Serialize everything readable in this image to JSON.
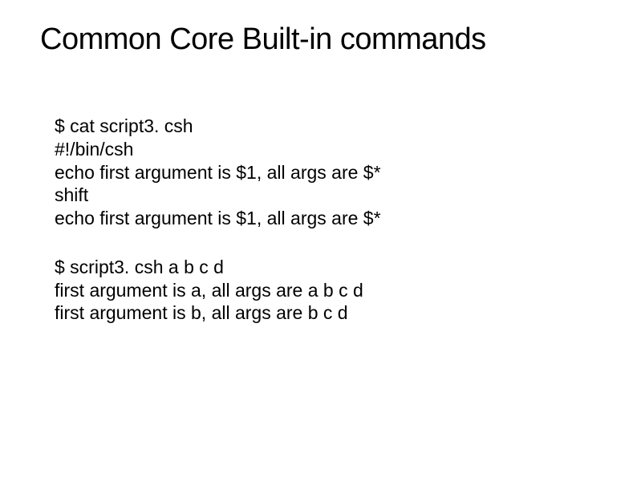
{
  "title": "Common Core Built-in commands",
  "block1": {
    "line1": "$ cat script3. csh",
    "line2": "#!/bin/csh",
    "line3": "echo first argument is $1, all args are $*",
    "line4": "shift",
    "line5": "echo first argument is $1, all args are $*"
  },
  "block2": {
    "line1": "$ script3. csh a b c d",
    "line2": "first argument is a, all args are a b c d",
    "line3": "first argument is b, all args are b c d"
  }
}
